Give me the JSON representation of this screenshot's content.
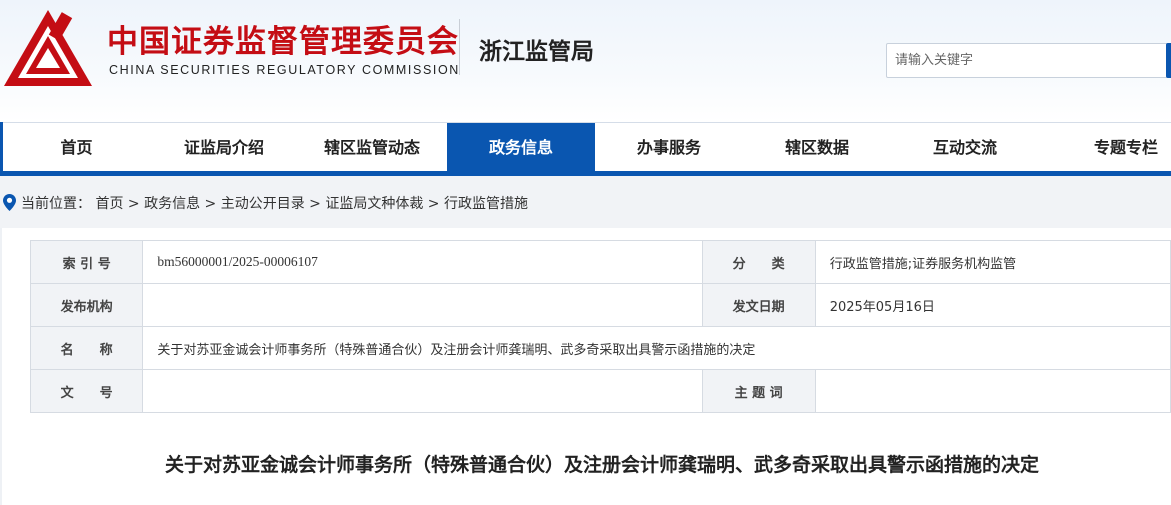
{
  "header": {
    "title_cn": "中国证券监督管理委员会",
    "title_en": "CHINA SECURITIES REGULATORY COMMISSION",
    "bureau": "浙江监管局",
    "search_placeholder": "请输入关键字",
    "brand_color": "#c40d14",
    "accent_color": "#0a56b0"
  },
  "nav": {
    "items": [
      {
        "label": "首页"
      },
      {
        "label": "证监局介绍"
      },
      {
        "label": "辖区监管动态"
      },
      {
        "label": "政务信息",
        "active": true
      },
      {
        "label": "办事服务"
      },
      {
        "label": "辖区数据"
      },
      {
        "label": "互动交流"
      },
      {
        "label": "专题专栏"
      }
    ]
  },
  "breadcrumb": {
    "text": "当前位置： 首页 > 政务信息 > 主动公开目录 > 证监局文种体裁 > 行政监管措施"
  },
  "meta": {
    "index_label": "索 引 号",
    "index_value": "bm56000001/2025-00006107",
    "category_label": "分　　类",
    "category_value": "行政监管措施;证券服务机构监管",
    "publisher_label": "发布机构",
    "publisher_value": "",
    "date_label": "发文日期",
    "date_value": "2025年05月16日",
    "name_label": "名　　称",
    "name_value": "关于对苏亚金诚会计师事务所（特殊普通合伙）及注册会计师龚瑞明、武多奇采取出具警示函措施的决定",
    "doc_no_label": "文　　号",
    "doc_no_value": "",
    "subject_label": "主 题 词",
    "subject_value": ""
  },
  "document": {
    "title": "关于对苏亚金诚会计师事务所（特殊普通合伙）及注册会计师龚瑞明、武多奇采取出具警示函措施的决定"
  }
}
